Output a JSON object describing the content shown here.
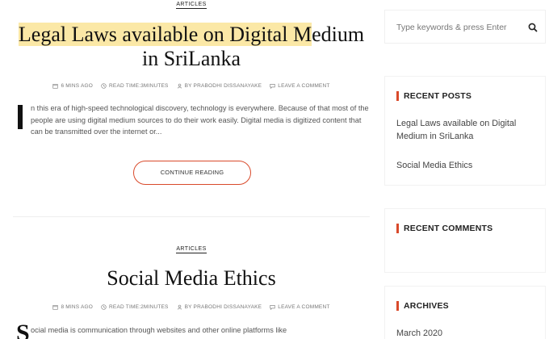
{
  "colors": {
    "accent": "#d94a2b",
    "highlight": "#fbe8a6"
  },
  "posts": [
    {
      "category": "ARTICLES",
      "title_highlighted": "Legal Laws available on Digital M",
      "title_rest_line1": "edium",
      "title_line2": "in SriLanka",
      "meta": {
        "time": "6 MINS AGO",
        "read": "READ TIME:3MINUTES",
        "author": "BY PRABODHI DISSANAYAKE",
        "comment": "LEAVE A COMMENT"
      },
      "dropcap": "I",
      "excerpt": "n this era of high-speed technological discovery, technology is everywhere. Because of that most of the people are using digital medium sources to do their work easily. Digital media is digitized content that can be transmitted over the internet or...",
      "button": "CONTINUE READING"
    },
    {
      "category": "ARTICLES",
      "title": "Social Media Ethics",
      "meta": {
        "time": "8 MINS AGO",
        "read": "READ TIME:2MINUTES",
        "author": "BY PRABODHI DISSANAYAKE",
        "comment": "LEAVE A COMMENT"
      },
      "dropcap": "S",
      "excerpt": "ocial media is communication through websites and other online platforms like"
    }
  ],
  "sidebar": {
    "search_placeholder": "Type keywords & press Enter",
    "search_icon": "search-icon",
    "recent_posts_title": "RECENT POSTS",
    "recent_posts": [
      "Legal Laws available on Digital Medium in SriLanka",
      "Social Media Ethics"
    ],
    "recent_comments_title": "RECENT COMMENTS",
    "archives_title": "ARCHIVES",
    "archives": [
      "March 2020"
    ]
  }
}
